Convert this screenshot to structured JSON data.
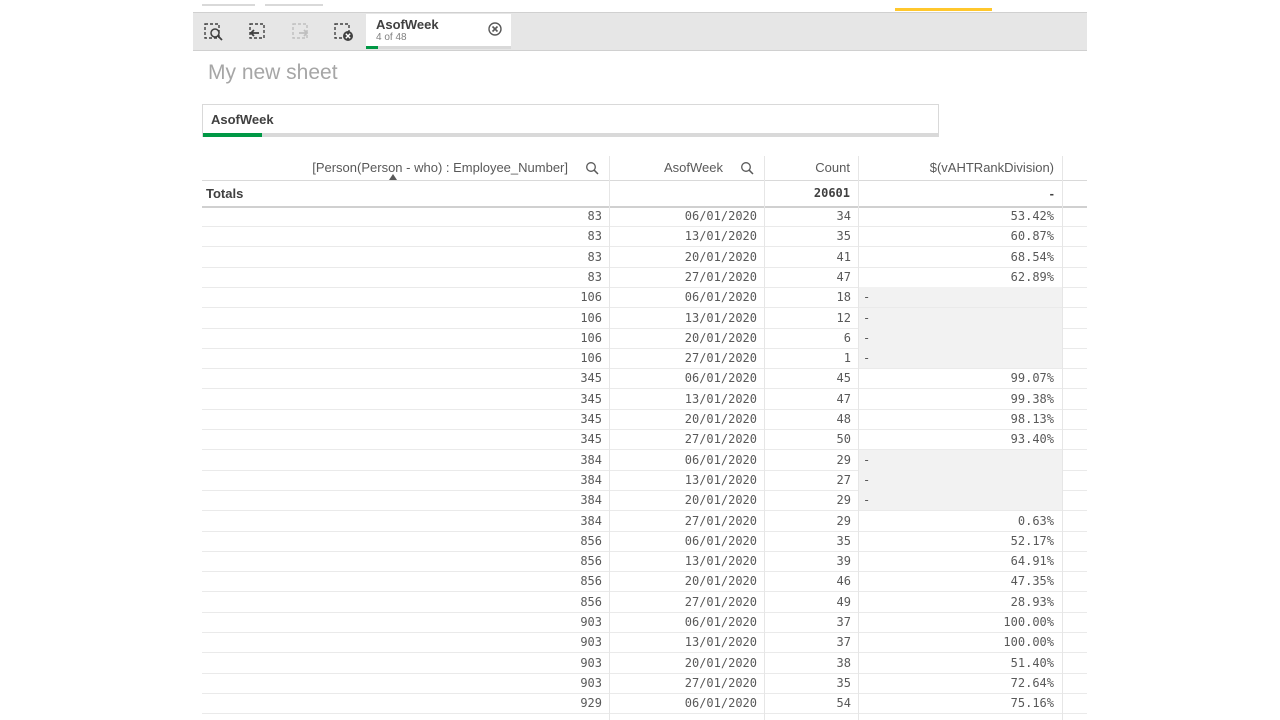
{
  "toolbar": {
    "tools": [
      {
        "name": "smart-search-icon"
      },
      {
        "name": "step-back-icon"
      },
      {
        "name": "step-forward-icon"
      },
      {
        "name": "clear-selections-icon"
      }
    ],
    "selection": {
      "field": "AsofWeek",
      "count_text": "4 of 48",
      "fraction": 0.083
    }
  },
  "sheet": {
    "title": "My new sheet"
  },
  "filter_pane": {
    "label": "AsofWeek",
    "selected_fraction": 0.08
  },
  "table": {
    "columns": [
      "[Person(Person - who) : Employee_Number]",
      "AsofWeek",
      "Count",
      "$(vAHTRankDivision)"
    ],
    "totals": {
      "label": "Totals",
      "count": "20601",
      "rank": "-"
    },
    "rows": [
      {
        "emp": "83",
        "week": "06/01/2020",
        "count": "34",
        "rank": "53.42%"
      },
      {
        "emp": "83",
        "week": "13/01/2020",
        "count": "35",
        "rank": "60.87%"
      },
      {
        "emp": "83",
        "week": "20/01/2020",
        "count": "41",
        "rank": "68.54%"
      },
      {
        "emp": "83",
        "week": "27/01/2020",
        "count": "47",
        "rank": "62.89%"
      },
      {
        "emp": "106",
        "week": "06/01/2020",
        "count": "18",
        "rank": "-",
        "null": true
      },
      {
        "emp": "106",
        "week": "13/01/2020",
        "count": "12",
        "rank": "-",
        "null": true
      },
      {
        "emp": "106",
        "week": "20/01/2020",
        "count": "6",
        "rank": "-",
        "null": true
      },
      {
        "emp": "106",
        "week": "27/01/2020",
        "count": "1",
        "rank": "-",
        "null": true
      },
      {
        "emp": "345",
        "week": "06/01/2020",
        "count": "45",
        "rank": "99.07%"
      },
      {
        "emp": "345",
        "week": "13/01/2020",
        "count": "47",
        "rank": "99.38%"
      },
      {
        "emp": "345",
        "week": "20/01/2020",
        "count": "48",
        "rank": "98.13%"
      },
      {
        "emp": "345",
        "week": "27/01/2020",
        "count": "50",
        "rank": "93.40%"
      },
      {
        "emp": "384",
        "week": "06/01/2020",
        "count": "29",
        "rank": "-",
        "null": true
      },
      {
        "emp": "384",
        "week": "13/01/2020",
        "count": "27",
        "rank": "-",
        "null": true
      },
      {
        "emp": "384",
        "week": "20/01/2020",
        "count": "29",
        "rank": "-",
        "null": true
      },
      {
        "emp": "384",
        "week": "27/01/2020",
        "count": "29",
        "rank": "0.63%"
      },
      {
        "emp": "856",
        "week": "06/01/2020",
        "count": "35",
        "rank": "52.17%"
      },
      {
        "emp": "856",
        "week": "13/01/2020",
        "count": "39",
        "rank": "64.91%"
      },
      {
        "emp": "856",
        "week": "20/01/2020",
        "count": "46",
        "rank": "47.35%"
      },
      {
        "emp": "856",
        "week": "27/01/2020",
        "count": "49",
        "rank": "28.93%"
      },
      {
        "emp": "903",
        "week": "06/01/2020",
        "count": "37",
        "rank": "100.00%"
      },
      {
        "emp": "903",
        "week": "13/01/2020",
        "count": "37",
        "rank": "100.00%"
      },
      {
        "emp": "903",
        "week": "20/01/2020",
        "count": "38",
        "rank": "51.40%"
      },
      {
        "emp": "903",
        "week": "27/01/2020",
        "count": "35",
        "rank": "72.64%"
      },
      {
        "emp": "929",
        "week": "06/01/2020",
        "count": "54",
        "rank": "75.16%"
      }
    ]
  }
}
